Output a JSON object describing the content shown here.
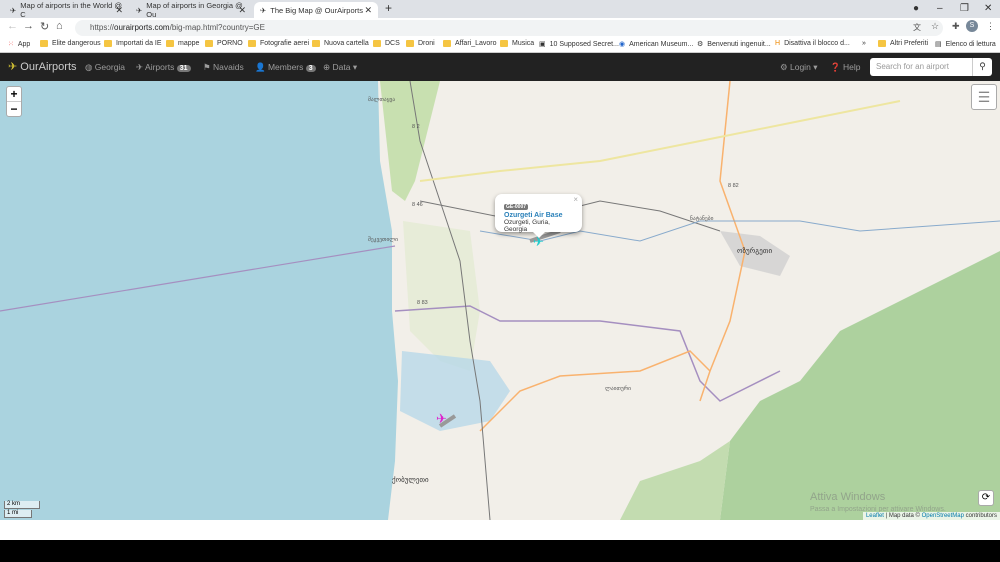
{
  "browser": {
    "tabs": [
      {
        "title": "Map of airports in the World @ C"
      },
      {
        "title": "Map of airports in Georgia @ Ou"
      },
      {
        "title": "The Big Map @ OurAirports"
      }
    ],
    "url_prefix": "https://",
    "url_domain": "ourairports.com",
    "url_path": "/big-map.html?country=GE",
    "profile_initial": "S",
    "bookmarks": [
      "App",
      "Elite dangerous",
      "Importati da IE",
      "mappe",
      "PORNO",
      "Fotografie aerei",
      "Nuova cartella",
      "DCS",
      "Droni",
      "Affari_Lavoro",
      "Musica",
      "10 Supposed Secret...",
      "American Museum...",
      "Benvenuti ingenuit...",
      "Disattiva il blocco d..."
    ],
    "more": "»",
    "other_bookmarks": "Altri Preferiti",
    "reading_list": "Elenco di lettura"
  },
  "navbar": {
    "brand": "OurAirports",
    "country": "Georgia",
    "airports": "Airports",
    "airports_count": "31",
    "navaids": "Navaids",
    "members": "Members",
    "members_count": "3",
    "data": "Data",
    "login": "Login",
    "help": "Help",
    "search_placeholder": "Search for an airport"
  },
  "map": {
    "zoom_in": "+",
    "zoom_out": "−",
    "popup": {
      "ident": "GE-0007",
      "name": "Ozurgeti Air Base",
      "location": "Ozurgeti, Guria, Georgia",
      "close": "×"
    },
    "scale_km": "2 km",
    "scale_mi": "1 mi",
    "attribution": {
      "leaflet": "Leaflet",
      "mid": " | Map data © ",
      "osm": "OpenStreetMap",
      "end": " contributors"
    },
    "watermark": "Attiva Windows",
    "watermark_sub": "Passa a Impostazioni per attivare Windows.",
    "labels": [
      "მალთაყვა",
      "ოზურგეთი",
      "ქობულეთი",
      "ნატანები",
      "ლაითური",
      "შეკვეთილი"
    ],
    "roads": [
      "8 2",
      "8 46",
      "8 82",
      "8 83"
    ],
    "colors": {
      "sea": "#aad3df",
      "land": "#f2efe9",
      "forest": "#add19e",
      "navbar": "#222222",
      "link": "#2a80b9"
    }
  }
}
